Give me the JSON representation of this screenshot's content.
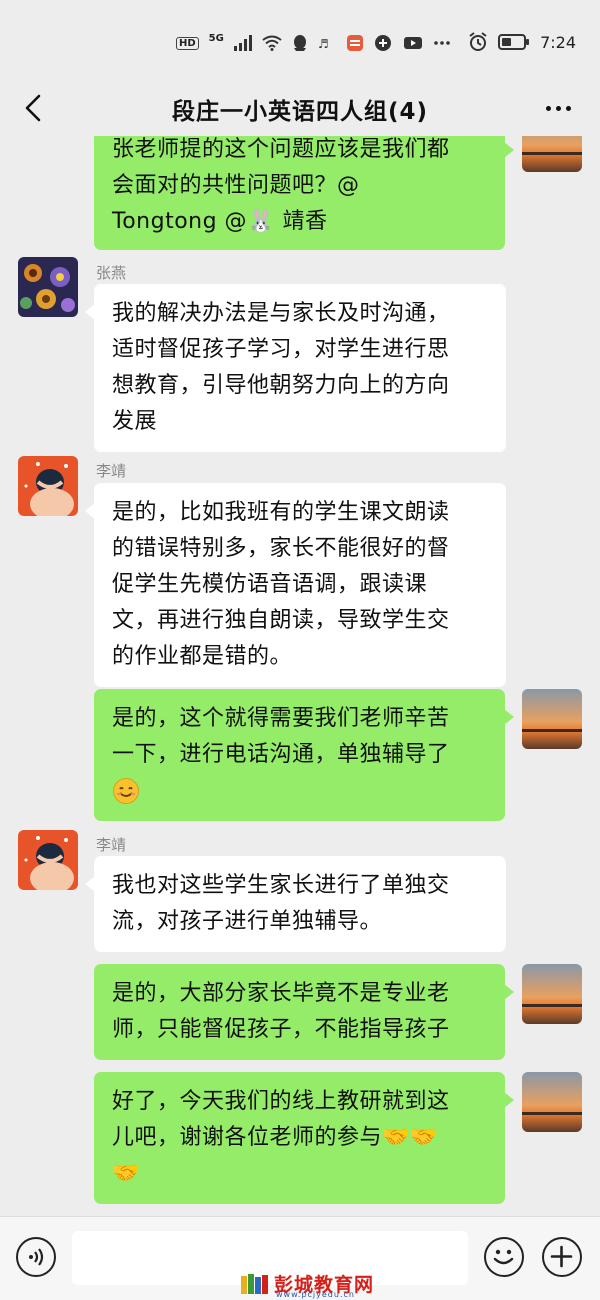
{
  "status_bar": {
    "left_indicators": [
      "HD",
      "5G"
    ],
    "time": "7:24",
    "icons": [
      "signal-icon",
      "wifi-icon",
      "qq-icon",
      "app-icon",
      "app-icon",
      "app-icon",
      "app-icon",
      "more-dots-icon",
      "alarm-icon",
      "battery-icon"
    ]
  },
  "header": {
    "title": "段庄一小英语四人组(4)",
    "back_icon": "chevron-left-icon",
    "more_icon": "more-horizontal-icon"
  },
  "messages": [
    {
      "side": "right",
      "lines": [
        "张老师提的这个问题应该是我们都",
        "会面对的共性问题吧？@",
        "Tongtong @🐰 靖香"
      ]
    },
    {
      "side": "left",
      "sender": "张燕",
      "lines": [
        "我的解决办法是与家长及时沟通，",
        "适时督促孩子学习，对学生进行思",
        "想教育，引导他朝努力向上的方向",
        "发展"
      ]
    },
    {
      "side": "left",
      "sender": "李靖",
      "lines": [
        "是的，比如我班有的学生课文朗读",
        "的错误特别多，家长不能很好的督",
        "促学生先模仿语音语调，跟读课",
        "文，再进行独自朗读，导致学生交",
        "的作业都是错的。"
      ]
    },
    {
      "side": "right",
      "lines": [
        "是的，这个就得需要我们老师辛苦",
        "一下，进行电话沟通，单独辅导了",
        "😊"
      ]
    },
    {
      "side": "left",
      "sender": "李靖",
      "lines": [
        "我也对这些学生家长进行了单独交",
        "流，对孩子进行单独辅导。"
      ]
    },
    {
      "side": "right",
      "lines": [
        "是的，大部分家长毕竟不是专业老",
        "师，只能督促孩子，不能指导孩子"
      ]
    },
    {
      "side": "right",
      "lines": [
        "好了，今天我们的线上教研就到这",
        "儿吧，谢谢各位老师的参与🤝🤝",
        "🤝"
      ]
    }
  ],
  "input_bar": {
    "placeholder": "",
    "voice_icon": "voice-icon",
    "emoji_icon": "emoji-icon",
    "plus_icon": "plus-icon"
  },
  "watermark": {
    "name": "彭城教育网",
    "url": "www.pcjyedu.cn"
  },
  "colors": {
    "background": "#ededed",
    "green_bubble": "#95ec69",
    "white_bubble": "#ffffff",
    "watermark_red": "#d3201a"
  }
}
